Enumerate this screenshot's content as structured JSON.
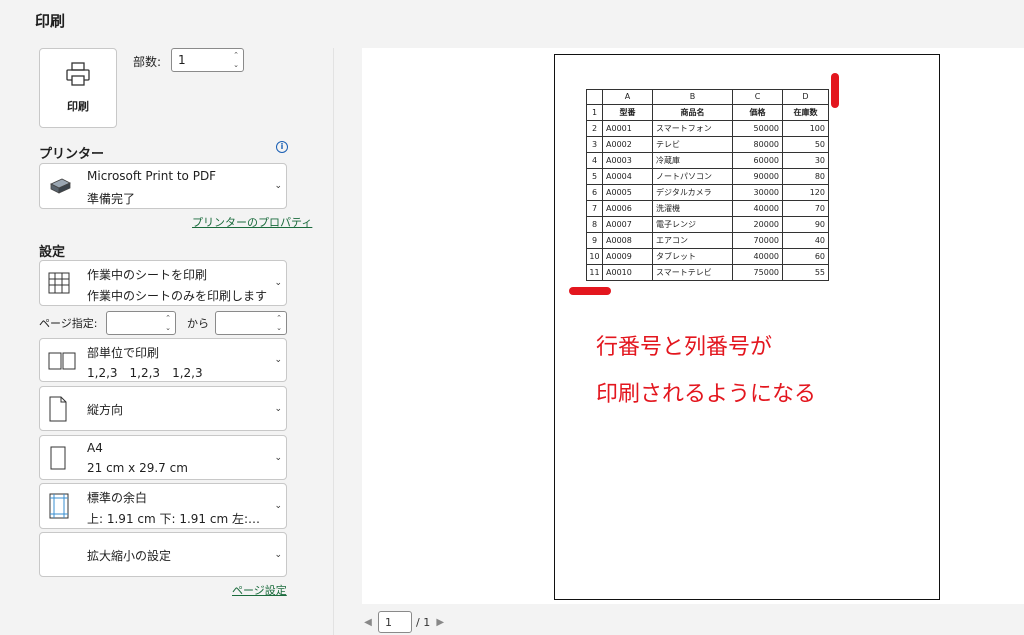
{
  "title": "印刷",
  "print_button": {
    "label": "印刷"
  },
  "copies": {
    "label": "部数:",
    "value": "1"
  },
  "printer": {
    "heading": "プリンター",
    "name": "Microsoft Print to PDF",
    "status": "準備完了",
    "properties_link": "プリンターのプロパティ"
  },
  "settings": {
    "heading": "設定",
    "scope": {
      "line1": "作業中のシートを印刷",
      "line2": "作業中のシートのみを印刷します"
    },
    "page_range": {
      "label": "ページ指定:",
      "to": "から",
      "from_value": "",
      "to_value": ""
    },
    "collation": {
      "line1": "部単位で印刷",
      "line2": "1,2,3　1,2,3　1,2,3"
    },
    "orientation": {
      "line1": "縦方向"
    },
    "paper": {
      "line1": "A4",
      "line2": "21 cm x 29.7 cm"
    },
    "margins": {
      "line1": "標準の余白",
      "line2": "上: 1.91 cm 下: 1.91 cm 左:…"
    },
    "scaling": {
      "line1": "拡大縮小の設定"
    },
    "page_setup_link": "ページ設定"
  },
  "sheet": {
    "columns": [
      "A",
      "B",
      "C",
      "D"
    ],
    "headers": [
      "型番",
      "商品名",
      "価格",
      "在庫数"
    ],
    "rows": [
      [
        "A0001",
        "スマートフォン",
        "50000",
        "100"
      ],
      [
        "A0002",
        "テレビ",
        "80000",
        "50"
      ],
      [
        "A0003",
        "冷蔵庫",
        "60000",
        "30"
      ],
      [
        "A0004",
        "ノートパソコン",
        "90000",
        "80"
      ],
      [
        "A0005",
        "デジタルカメラ",
        "30000",
        "120"
      ],
      [
        "A0006",
        "洗濯機",
        "40000",
        "70"
      ],
      [
        "A0007",
        "電子レンジ",
        "20000",
        "90"
      ],
      [
        "A0008",
        "エアコン",
        "70000",
        "40"
      ],
      [
        "A0009",
        "タブレット",
        "40000",
        "60"
      ],
      [
        "A0010",
        "スマートテレビ",
        "75000",
        "55"
      ]
    ]
  },
  "annotation": {
    "line1": "行番号と列番号が",
    "line2": "印刷されるようになる",
    "color": "#e3161e"
  },
  "pager": {
    "current": "1",
    "total": "/ 1"
  },
  "icons": {
    "printer": "printer-icon",
    "info": "info-icon",
    "printer_device": "printer-device-icon",
    "sheet": "sheet-grid-icon",
    "collate": "collate-icon",
    "orientation": "portrait-page-icon",
    "paper": "paper-size-icon",
    "margins": "margins-icon",
    "chevron": "chevron-down-icon"
  }
}
